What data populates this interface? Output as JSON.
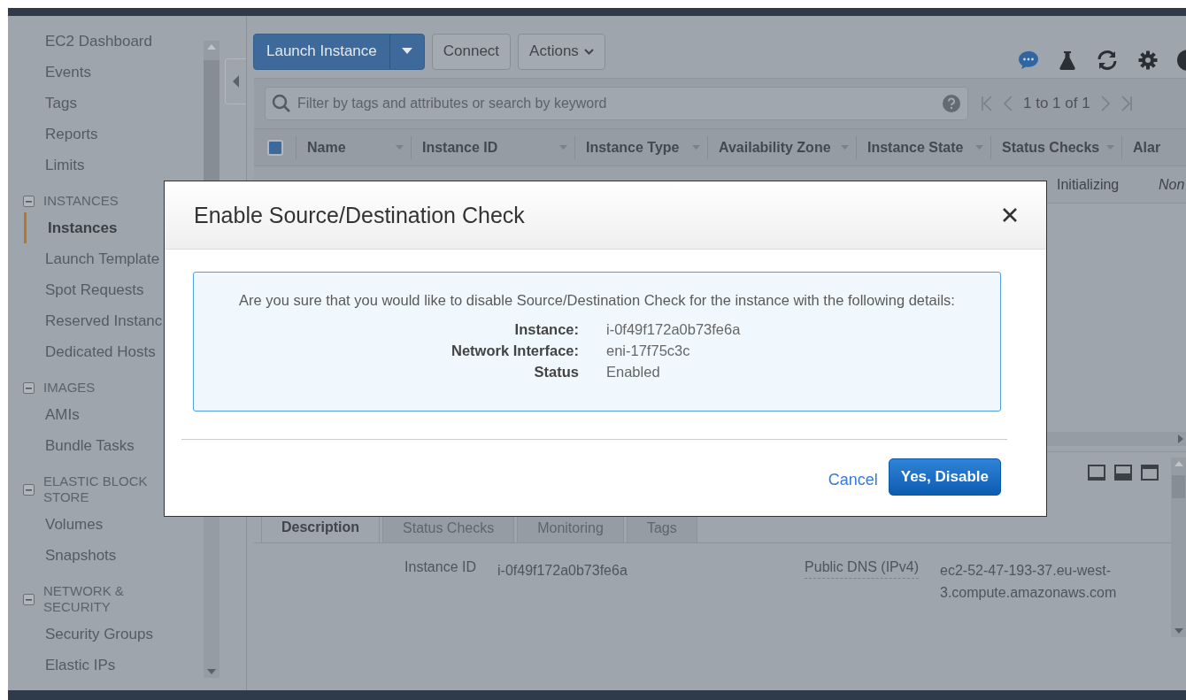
{
  "sidebar": {
    "items": [
      {
        "label": "EC2 Dashboard",
        "selected": false
      },
      {
        "label": "Events",
        "selected": false
      },
      {
        "label": "Tags",
        "selected": false
      },
      {
        "label": "Reports",
        "selected": false
      },
      {
        "label": "Limits",
        "selected": false
      }
    ],
    "sections": [
      {
        "title": "INSTANCES",
        "expanded": true,
        "items": [
          {
            "label": "Instances",
            "selected": true
          },
          {
            "label": "Launch Template",
            "selected": false
          },
          {
            "label": "Spot Requests",
            "selected": false
          },
          {
            "label": "Reserved Instanc",
            "selected": false
          },
          {
            "label": "Dedicated Hosts",
            "selected": false
          }
        ]
      },
      {
        "title": "IMAGES",
        "expanded": true,
        "items": [
          {
            "label": "AMIs",
            "selected": false
          },
          {
            "label": "Bundle Tasks",
            "selected": false
          }
        ]
      },
      {
        "title": "ELASTIC BLOCK STORE",
        "expanded": true,
        "items": [
          {
            "label": "Volumes",
            "selected": false
          },
          {
            "label": "Snapshots",
            "selected": false
          }
        ]
      },
      {
        "title": "NETWORK & SECURITY",
        "expanded": true,
        "items": [
          {
            "label": "Security Groups",
            "selected": false
          },
          {
            "label": "Elastic IPs",
            "selected": false
          }
        ]
      }
    ]
  },
  "toolbar": {
    "launch_button": "Launch Instance",
    "connect_button": "Connect",
    "actions_button": "Actions"
  },
  "search": {
    "placeholder": "Filter by tags and attributes or search by keyword"
  },
  "pagination": {
    "range": "1 to 1 of 1"
  },
  "table": {
    "select_all_checked": true,
    "columns": [
      "Name",
      "Instance ID",
      "Instance Type",
      "Availability Zone",
      "Instance State",
      "Status Checks",
      "Alar"
    ],
    "rows": [
      {
        "cells": [
          "",
          "",
          "",
          "",
          "",
          "Initializing",
          "Non"
        ]
      }
    ]
  },
  "details": {
    "tabs": [
      {
        "label": "Description",
        "selected": true
      },
      {
        "label": "Status Checks",
        "selected": false
      },
      {
        "label": "Monitoring",
        "selected": false
      },
      {
        "label": "Tags",
        "selected": false
      }
    ],
    "left_fields": [
      {
        "label": "Instance ID",
        "value": "i-0f49f172a0b73fe6a"
      }
    ],
    "right_fields": [
      {
        "label": "Public DNS (IPv4)",
        "value": "ec2-52-47-193-37.eu-west-3.compute.amazonaws.com"
      }
    ]
  },
  "modal": {
    "title": "Enable Source/Destination Check",
    "message": "Are you sure that you would like to disable Source/Destination Check for the instance with the following details:",
    "details": [
      {
        "label": "Instance:",
        "value": "i-0f49f172a0b73fe6a"
      },
      {
        "label": "Network Interface:",
        "value": "eni-17f75c3c"
      },
      {
        "label": "Status",
        "value": "Enabled"
      }
    ],
    "cancel": "Cancel",
    "confirm": "Yes, Disable"
  }
}
